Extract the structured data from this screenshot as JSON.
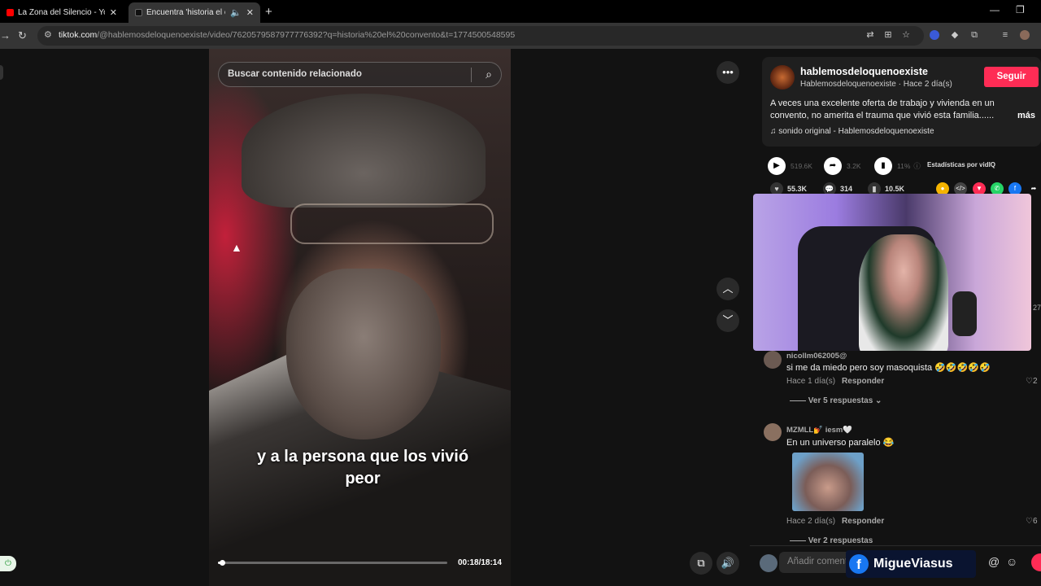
{
  "browser": {
    "tabs": [
      {
        "title": "La Zona del Silencio - YouTube",
        "favicon_color": "#ff0000"
      },
      {
        "title": "Encuentra 'historia el convento'",
        "favicon_color": "#000000"
      }
    ],
    "url_domain": "tiktok.com",
    "url_path": "/@hablemosdeloquenoexiste/video/7620579587977776392?q=historia%20el%20convento&t=1774500548595"
  },
  "search": {
    "placeholder": "Buscar contenido relacionado"
  },
  "video": {
    "caption_line1": "y a la persona que los vivió",
    "caption_line2": "peor",
    "time": "00:18/18:14",
    "progress_fraction": 0.017
  },
  "post": {
    "username": "hablemosdeloquenoexiste",
    "subline": "Hablemosdeloquenoexiste · Hace 2 día(s)",
    "follow_label": "Seguir",
    "description": "A veces una excelente oferta de trabajo y vivienda en un convento, no amerita el trauma que vivió esta familia......",
    "more_label": "más",
    "sound": "sonido original - Hablemosdeloquenoexiste"
  },
  "stats": {
    "views": "519.6K",
    "shares": "3.2K",
    "percent": "11%",
    "vidiq_label": "Estadísticas por vidIQ"
  },
  "actions": {
    "likes": "55.3K",
    "comments": "314",
    "saves": "10.5K"
  },
  "comments": [
    {
      "user": "nicollm062005@",
      "text": "si me da miedo pero soy masoquista 🤣🤣🤣🤣🤣",
      "time": "Hace 1 día(s)",
      "reply_label": "Responder",
      "replies_label": "Ver 5 respuestas",
      "likes": "2"
    },
    {
      "user": "MZMLL💅 iesm🤍",
      "text": "En un universo paralelo 😂",
      "time": "Hace 2 día(s)",
      "reply_label": "Responder",
      "replies_label": "Ver 2 respuestas",
      "likes": "6"
    }
  ],
  "composer": {
    "placeholder": "Añadir comentario..."
  },
  "overlay": {
    "name": "MigueViasus"
  },
  "side_number": "27",
  "colors": {
    "accent": "#fe2c55",
    "facebook": "#1877f2"
  }
}
